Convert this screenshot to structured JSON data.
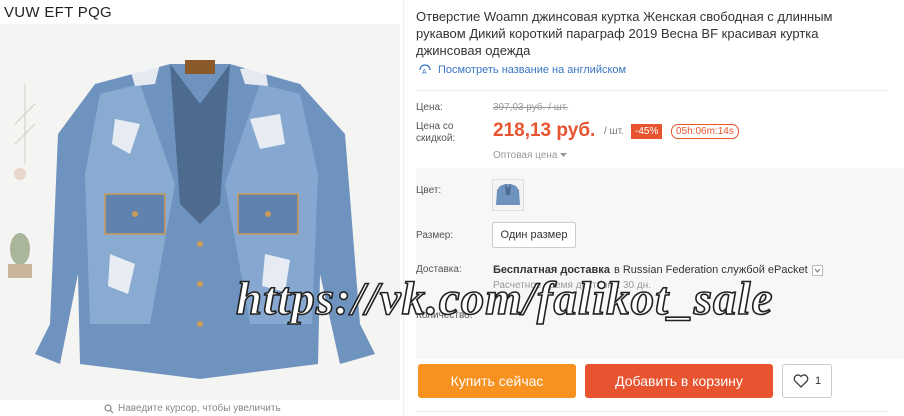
{
  "brand": "VUW EFT PQG",
  "image": {
    "zoom_hint": "Наведите курсор, чтобы увеличить"
  },
  "product": {
    "title": "Отверстие Woamn джинсовая куртка Женская свободная с длинным рукавом Дикий короткий параграф 2019 Весна BF красивая куртка джинсовая одежда",
    "translate_link": "Посмотреть название на английском"
  },
  "pricing": {
    "price_label": "Цена:",
    "old_price": "397,03 руб. / шт.",
    "discount_price_label": "Цена со скидкой:",
    "price": "218,13 руб.",
    "per_unit": "/ шт.",
    "discount": "-45%",
    "timer": "05h:06m:14s",
    "wholesale": "Оптовая цена"
  },
  "options": {
    "color_label": "Цвет:",
    "size_label": "Размер:",
    "size_value": "Один размер",
    "delivery_label": "Доставка:",
    "delivery_text_bold": "Бесплатная доставка",
    "delivery_text_rest": "в Russian Federation службой ePacket",
    "delivery_time": "Расчетное время доставки: 30 дн.",
    "quantity_label": "Количество:"
  },
  "actions": {
    "buy_now": "Купить сейчас",
    "add_to_cart": "Добавить в корзину",
    "wishlist_count": "1"
  },
  "watermark": "https://vk.com/falikot_sale",
  "colors": {
    "accent_red": "#e8542f",
    "accent_orange": "#f7911f",
    "link_blue": "#3a75c4"
  }
}
